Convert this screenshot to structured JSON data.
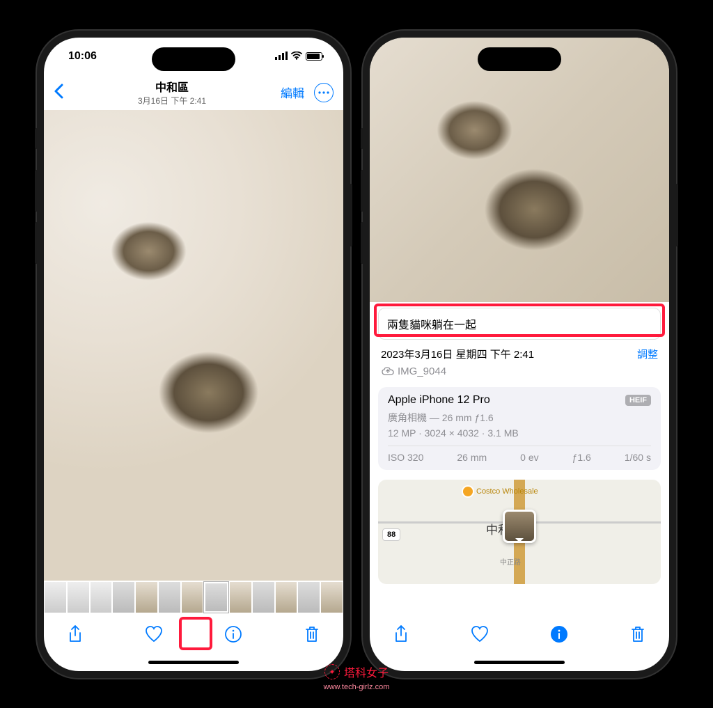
{
  "colors": {
    "accent": "#007aff",
    "highlight": "#ff1a3c"
  },
  "left": {
    "status": {
      "time": "10:06"
    },
    "nav": {
      "title": "中和區",
      "subtitle": "3月16日 下午 2:41",
      "edit": "編輯"
    }
  },
  "right": {
    "caption": "兩隻貓咪躺在一起",
    "datetime": "2023年3月16日 星期四 下午 2:41",
    "adjust": "調整",
    "filename": "IMG_9044",
    "device": {
      "name": "Apple iPhone 12 Pro",
      "format": "HEIF",
      "lens": "廣角相機 — 26 mm ƒ1.6",
      "specs": "12 MP · 3024 × 4032 · 3.1 MB",
      "iso": "ISO 320",
      "focal": "26 mm",
      "ev": "0 ev",
      "aperture": "ƒ1.6",
      "shutter": "1/60 s"
    },
    "map": {
      "district": "中和區",
      "poi": "Costco Wholesale",
      "route": "88",
      "road": "中正路"
    }
  },
  "watermark": {
    "text": "塔科女子",
    "url": "www.tech-girlz.com"
  }
}
